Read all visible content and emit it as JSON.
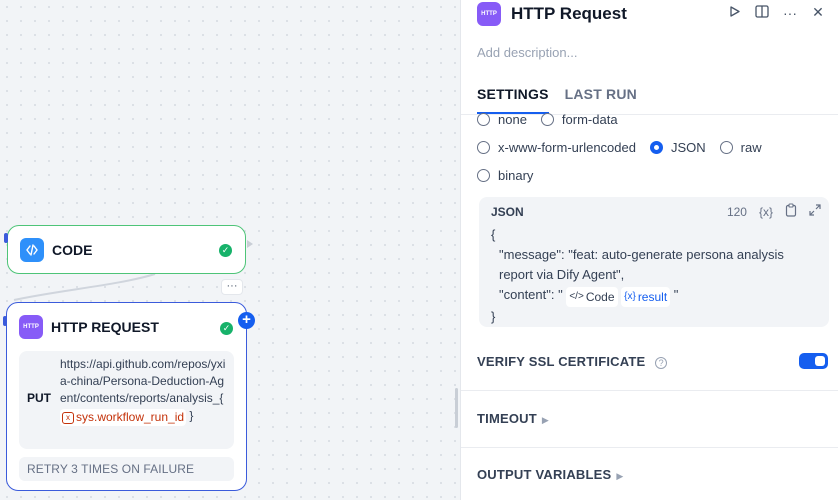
{
  "canvas": {
    "code_node": {
      "title": "CODE",
      "icon": "code-icon"
    },
    "http_node": {
      "title": "HTTP REQUEST",
      "icon": "http-icon",
      "icon_text": "HTTP",
      "method": "PUT",
      "url": "https://api.github.com/repos/yxia-china/Persona-Deduction-Agent/contents/reports/analysis_{",
      "url_var": "sys.workflow_run_id",
      "url_tail": "}",
      "retry": "RETRY 3 TIMES ON FAILURE"
    },
    "more_label": "···",
    "add_label": "+"
  },
  "panel": {
    "icon_text": "HTTP",
    "title": "HTTP Request",
    "description_placeholder": "Add description...",
    "tabs": [
      {
        "label": "SETTINGS",
        "active": true
      },
      {
        "label": "LAST RUN",
        "active": false
      }
    ],
    "body_types": [
      {
        "label": "none",
        "selected": false
      },
      {
        "label": "form-data",
        "selected": false
      },
      {
        "label": "x-www-form-urlencoded",
        "selected": false
      },
      {
        "label": "JSON",
        "selected": true
      },
      {
        "label": "raw",
        "selected": false
      },
      {
        "label": "binary",
        "selected": false
      }
    ],
    "json_editor": {
      "label": "JSON",
      "count": "120",
      "var_tool": "{x}",
      "open_brace": "{",
      "line1": "\"message\": \"feat: auto-generate persona analysis report via Dify Agent\",",
      "line2_prefix": "\"content\": \"",
      "chip_code": "Code",
      "chip_result": "result",
      "line2_suffix": "\"",
      "close_brace": "}"
    },
    "verify_ssl": {
      "label": "VERIFY SSL CERTIFICATE",
      "enabled": true
    },
    "timeout": {
      "label": "TIMEOUT"
    },
    "output_variables": {
      "label": "OUTPUT VARIABLES"
    }
  },
  "colors": {
    "accent": "#155eef",
    "success": "#17b26a",
    "http_icon": "#875bf7",
    "code_icon": "#2e90fa",
    "variable": "#c4320a"
  }
}
